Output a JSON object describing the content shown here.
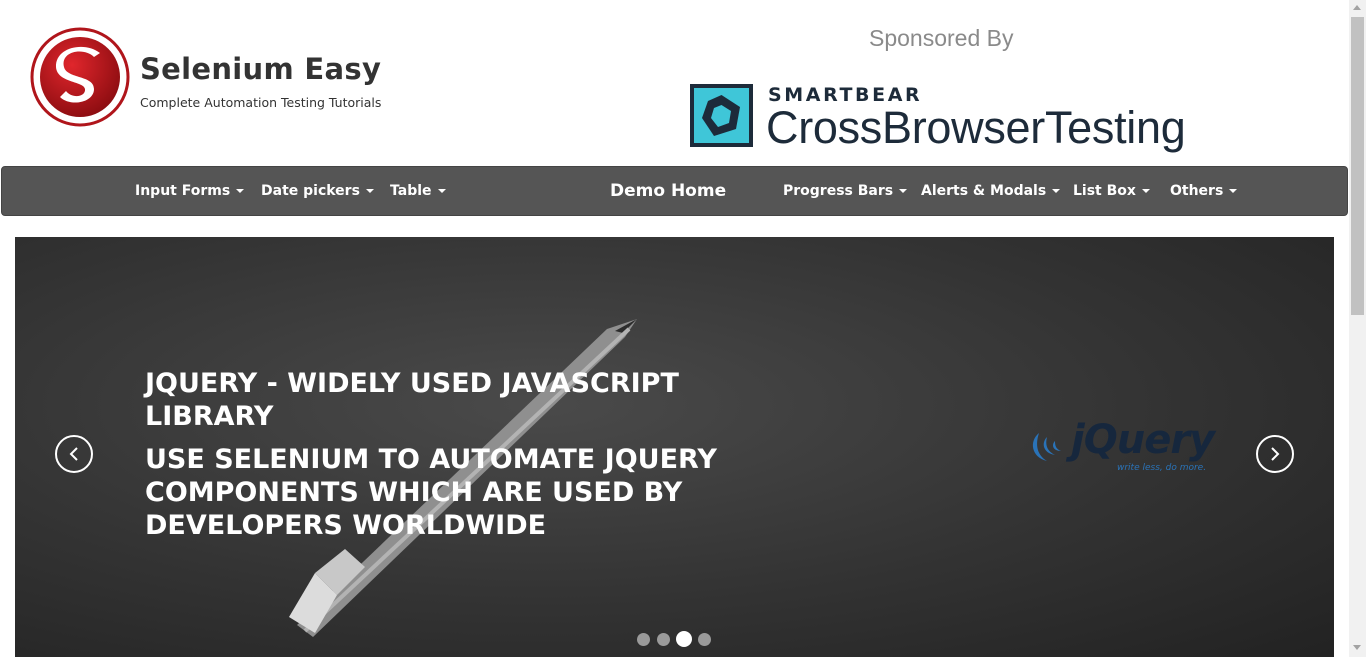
{
  "header": {
    "site_title": "Selenium Easy",
    "tagline": "Complete Automation Testing Tutorials",
    "sponsored_by": "Sponsored By",
    "sponsor_brand": "SMARTBEAR",
    "sponsor_product": "CrossBrowserTesting"
  },
  "nav": {
    "items": [
      {
        "label": "Input Forms",
        "has_caret": true
      },
      {
        "label": "Date pickers",
        "has_caret": true
      },
      {
        "label": "Table",
        "has_caret": true
      },
      {
        "label": "Demo Home",
        "has_caret": false
      },
      {
        "label": "Progress Bars",
        "has_caret": true
      },
      {
        "label": "Alerts & Modals",
        "has_caret": true
      },
      {
        "label": "List Box",
        "has_caret": true
      },
      {
        "label": "Others",
        "has_caret": true
      }
    ]
  },
  "carousel": {
    "heading": "JQUERY - WIDELY USED JAVASCRIPT LIBRARY",
    "subheading": "USE SELENIUM TO AUTOMATE JQUERY COMPONENTS WHICH ARE USED BY DEVELOPERS WORLDWIDE",
    "logo_text": "jQuery",
    "logo_tagline": "write less, do more.",
    "slide_count": 4,
    "active_index": 2
  },
  "colors": {
    "navbar": "#555555",
    "brand_red": "#c0131b",
    "sponsor_teal": "#3fc6d8",
    "sponsor_navy": "#1d2b3a",
    "jquery_blue": "#2a73b8"
  },
  "icons": [
    "selenium-easy-logo-icon",
    "smartbear-icon",
    "chevron-left-icon",
    "chevron-right-icon",
    "jquery-logo-icon"
  ]
}
